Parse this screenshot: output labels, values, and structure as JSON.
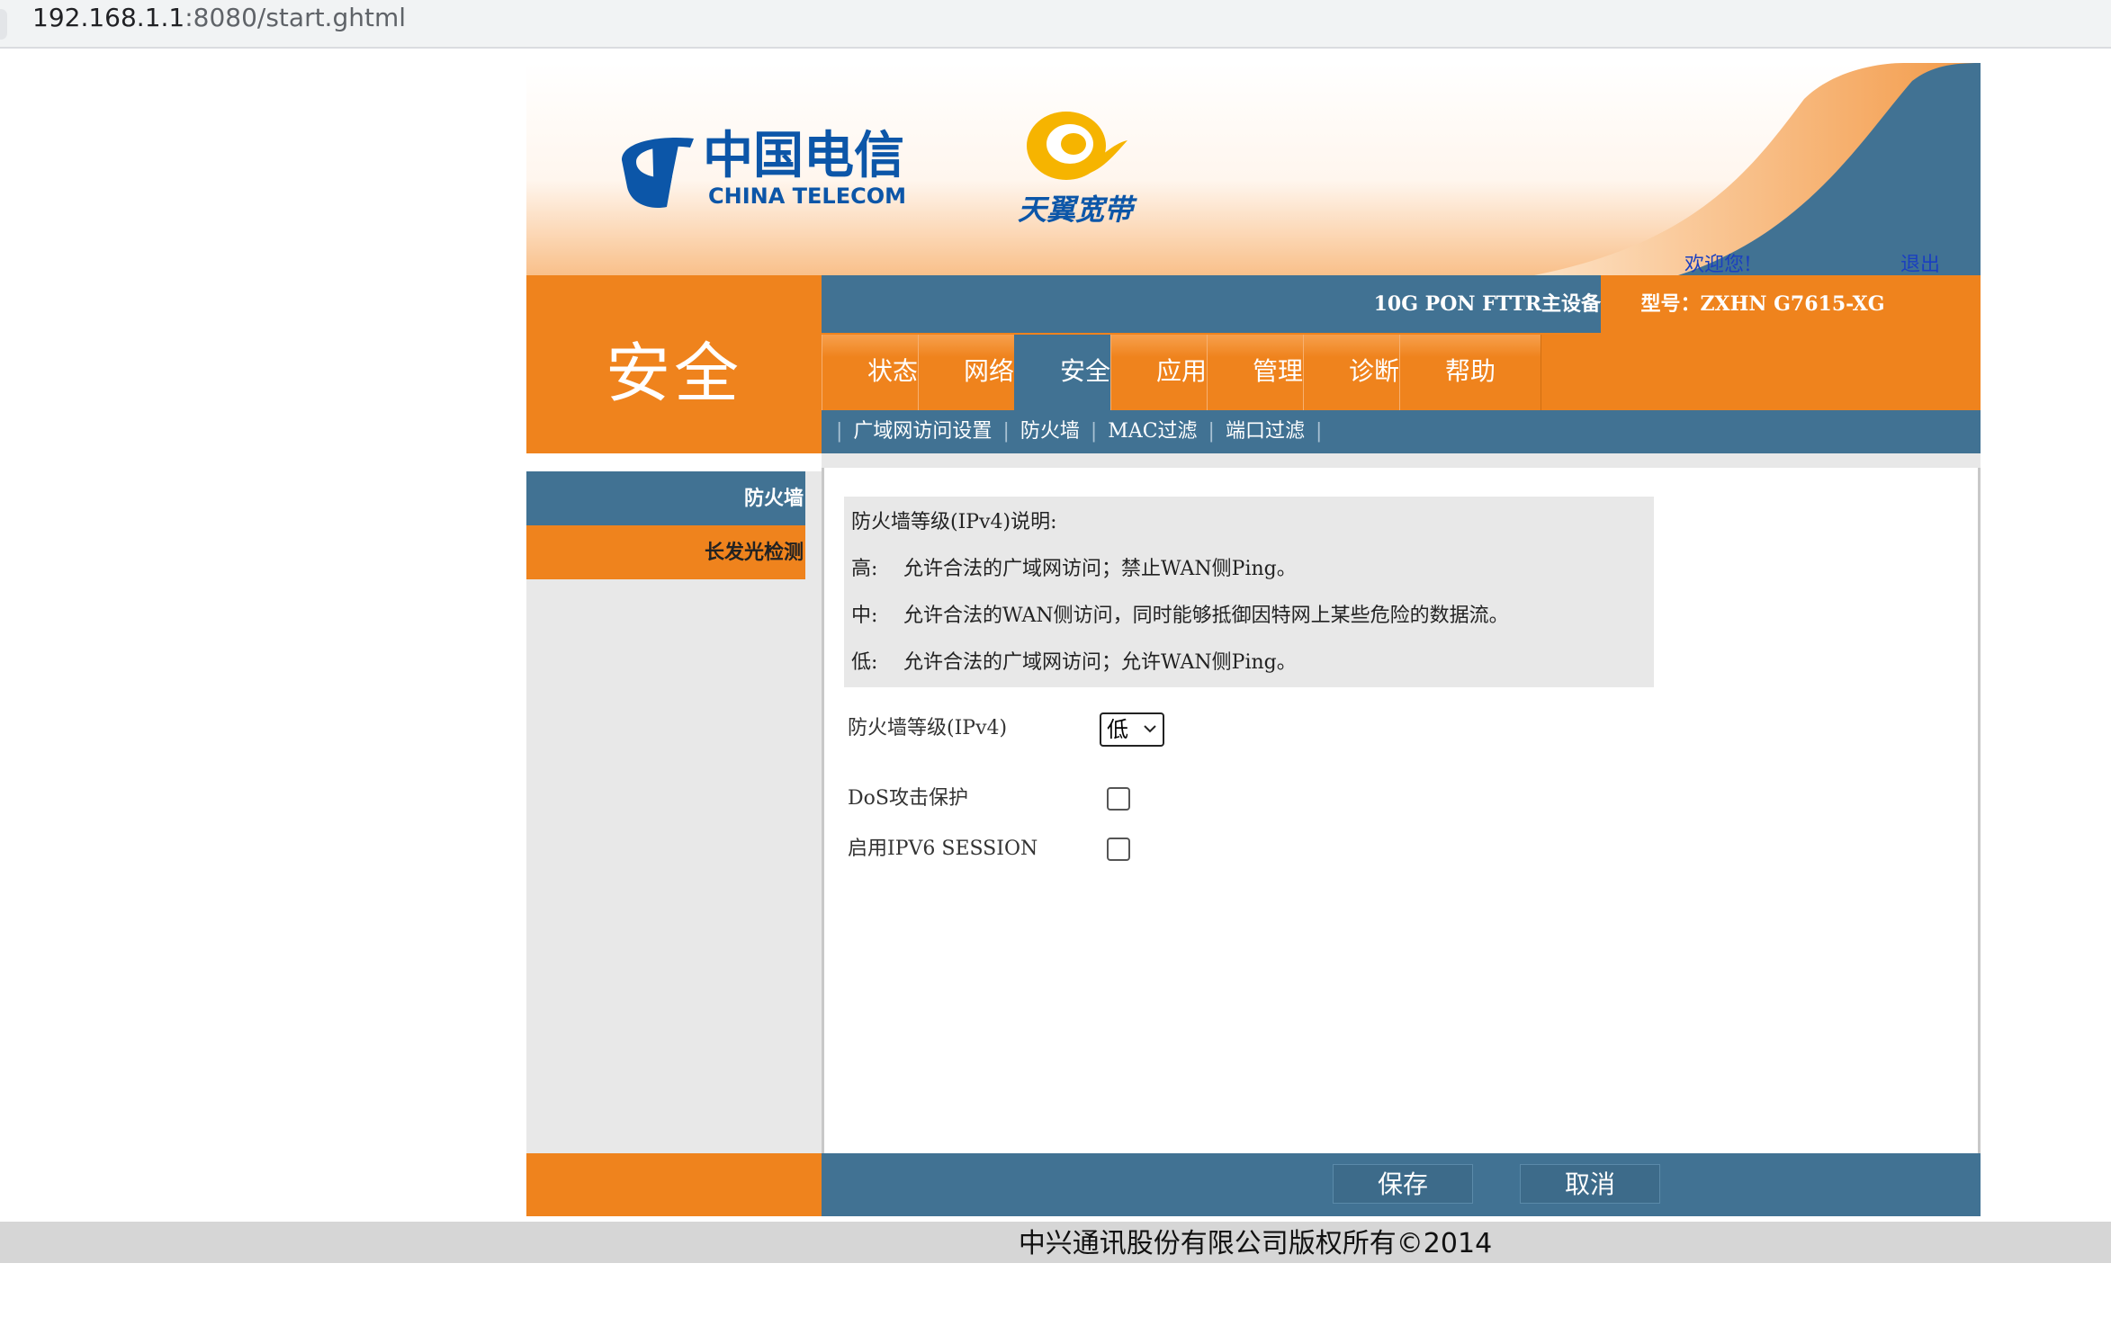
{
  "browser": {
    "url_host": "192.168.1.1",
    "url_rest": ":8080/start.ghtml"
  },
  "header": {
    "brand_cn": "中国电信",
    "brand_en": "CHINA TELECOM",
    "sub_brand": "天翼宽带",
    "welcome": "欢迎您!",
    "logout": "退出"
  },
  "section_title": "安全",
  "device": {
    "description": "10G PON FTTR主设备",
    "model": "型号：ZXHN G7615-XG"
  },
  "tabs": [
    {
      "label": "状态"
    },
    {
      "label": "网络"
    },
    {
      "label": "安全",
      "active": true
    },
    {
      "label": "应用"
    },
    {
      "label": "管理"
    },
    {
      "label": "诊断"
    },
    {
      "label": "帮助"
    }
  ],
  "subnav": [
    {
      "label": "广域网访问设置"
    },
    {
      "label": "防火墙",
      "active": true
    },
    {
      "label": "MAC过滤"
    },
    {
      "label": "端口过滤"
    }
  ],
  "left_menu": [
    {
      "label": "防火墙",
      "active": true
    },
    {
      "label": "长发光检测"
    }
  ],
  "firewall": {
    "desc_title": "防火墙等级(IPv4)说明:",
    "levels": [
      {
        "name": "高:",
        "text": "允许合法的广域网访问；禁止WAN侧Ping。"
      },
      {
        "name": "中:",
        "text": "允许合法的WAN侧访问，同时能够抵御因特网上某些危险的数据流。"
      },
      {
        "name": "低:",
        "text": "允许合法的广域网访问；允许WAN侧Ping。"
      }
    ],
    "level_label": "防火墙等级(IPv4)",
    "level_value": "低",
    "dos_label": "DoS攻击保护",
    "dos_checked": false,
    "ipv6_label": "启用IPV6 SESSION",
    "ipv6_checked": false
  },
  "buttons": {
    "save": "保存",
    "cancel": "取消"
  },
  "copyright": "中兴通讯股份有限公司版权所有©2014",
  "colors": {
    "orange": "#ef831d",
    "blue": "#417293",
    "link": "#1a3fc0"
  }
}
